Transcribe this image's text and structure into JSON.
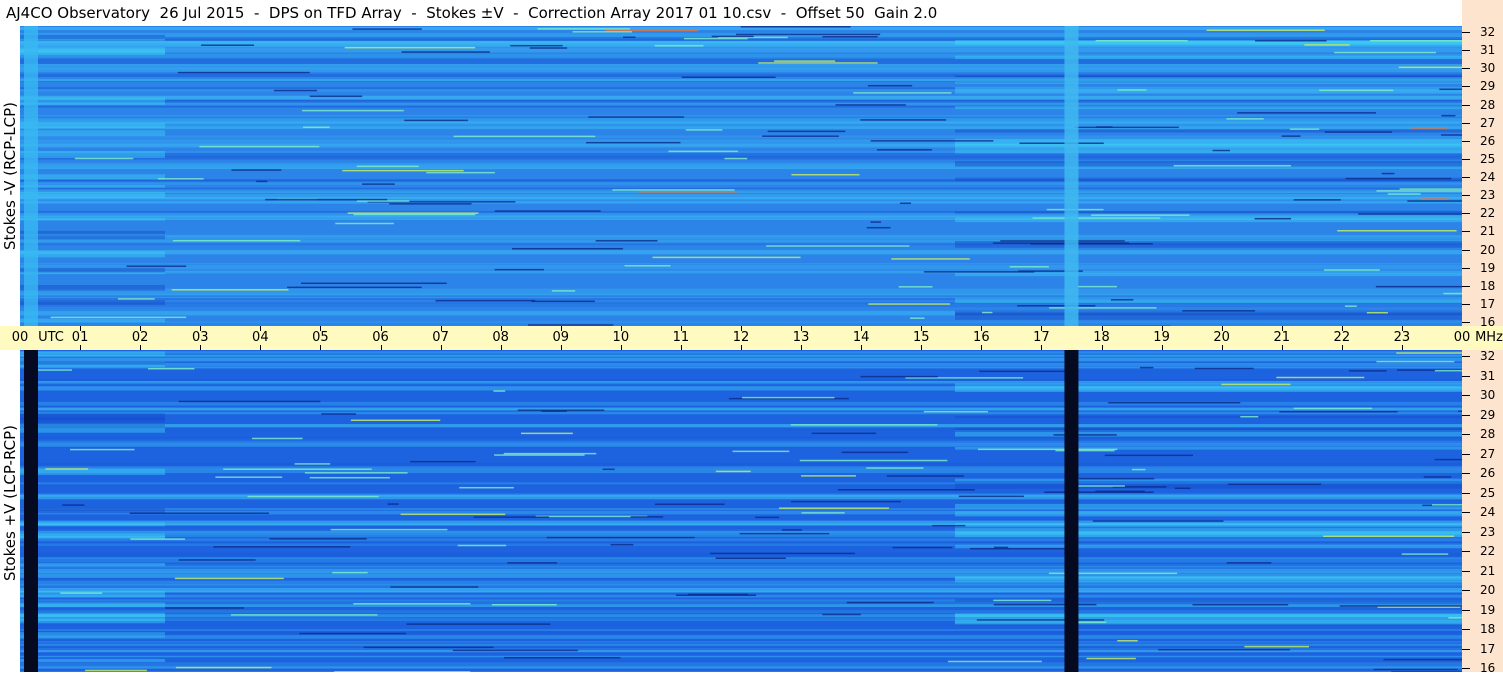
{
  "title": "AJ4CO Observatory  26 Jul 2015  -  DPS on TFD Array  -  Stokes ±V  -  Correction Array 2017 01 10.csv  -  Offset 50  Gain 2.0",
  "colors": {
    "top_base": "#2c84e8",
    "bottom_base": "#1d63e0",
    "time_bar": "#fffac0",
    "right_strip": "#fde4cf"
  },
  "chart_data": [
    {
      "type": "heatmap",
      "ylabel": "Stokes -V (RCP-LCP)",
      "x_unit": "UTC",
      "y_unit": "MHz",
      "xlim": [
        0,
        24
      ],
      "ylim": [
        16,
        32
      ],
      "x_ticks": [
        "00",
        "01",
        "02",
        "03",
        "04",
        "05",
        "06",
        "07",
        "08",
        "09",
        "10",
        "11",
        "12",
        "13",
        "14",
        "15",
        "16",
        "17",
        "18",
        "19",
        "20",
        "21",
        "22",
        "23",
        "00"
      ],
      "y_ticks": [
        "32",
        "31",
        "30",
        "29",
        "28",
        "27",
        "26",
        "25",
        "24",
        "23",
        "22",
        "21",
        "20",
        "19",
        "18",
        "17",
        "16"
      ]
    },
    {
      "type": "heatmap",
      "ylabel": "Stokes +V (LCP-RCP)",
      "x_unit": "UTC",
      "y_unit": "MHz",
      "xlim": [
        0,
        24
      ],
      "ylim": [
        16,
        32
      ],
      "x_ticks": [
        "00",
        "01",
        "02",
        "03",
        "04",
        "05",
        "06",
        "07",
        "08",
        "09",
        "10",
        "11",
        "12",
        "13",
        "14",
        "15",
        "16",
        "17",
        "18",
        "19",
        "20",
        "21",
        "22",
        "23",
        "00"
      ],
      "y_ticks": [
        "32",
        "31",
        "30",
        "29",
        "28",
        "27",
        "26",
        "25",
        "24",
        "23",
        "22",
        "21",
        "20",
        "19",
        "18",
        "17",
        "16"
      ]
    }
  ],
  "time_axis": {
    "start_label": "00",
    "utc_label": "UTC",
    "end_label": "00",
    "mhz_label": "MHz",
    "hours": [
      "01",
      "02",
      "03",
      "04",
      "05",
      "06",
      "07",
      "08",
      "09",
      "10",
      "11",
      "12",
      "13",
      "14",
      "15",
      "16",
      "17",
      "18",
      "19",
      "20",
      "21",
      "22",
      "23"
    ]
  }
}
